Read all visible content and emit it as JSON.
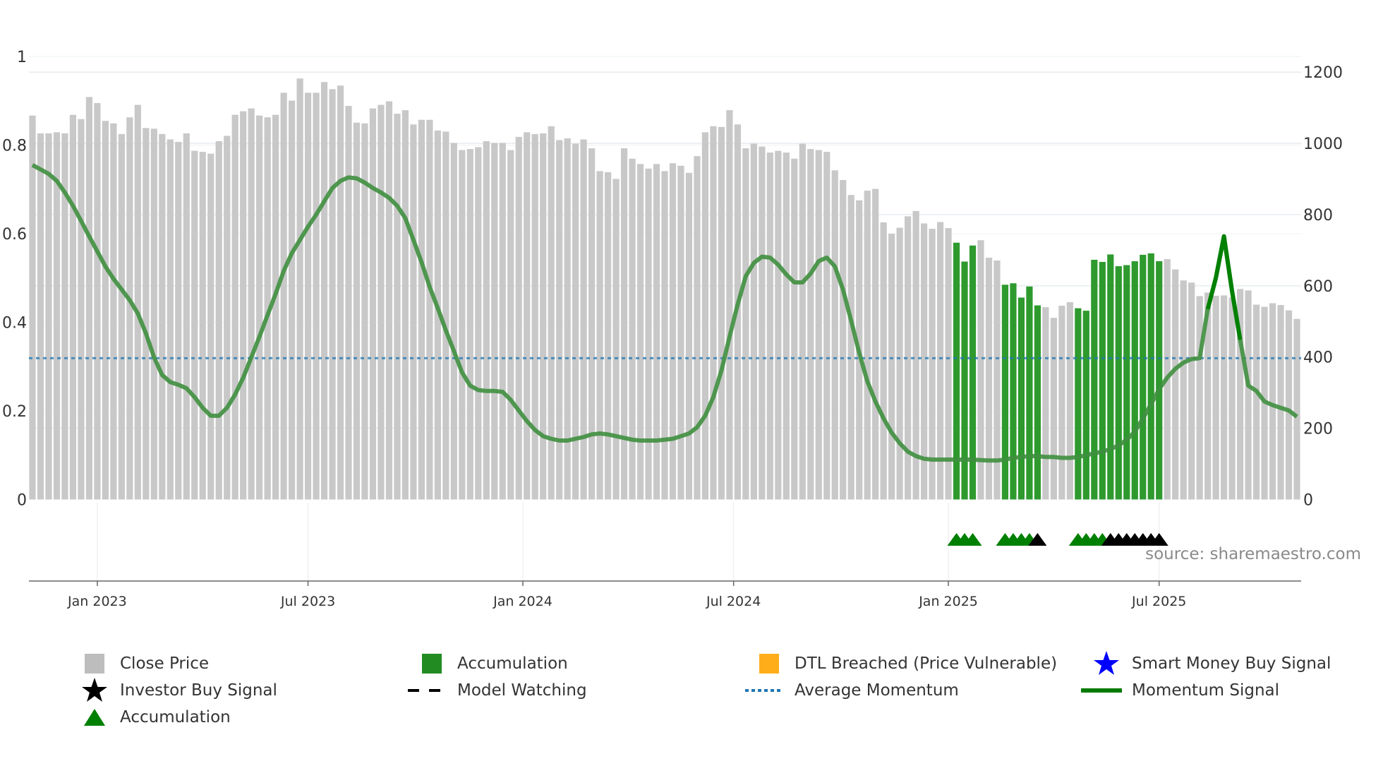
{
  "chart_data": {
    "type": "bar",
    "title": "",
    "source": "source: sharemaestro.com",
    "left_axis": {
      "ticks": [
        "0",
        "0.2",
        "0.4",
        "0.6",
        "0.8",
        "1"
      ],
      "range": [
        0,
        1
      ]
    },
    "right_axis": {
      "ticks": [
        "0",
        "200",
        "400",
        "600",
        "800",
        "1000",
        "1200"
      ],
      "range": [
        0,
        1200
      ]
    },
    "x_ticks": [
      "Jan 2023",
      "Jul 2023",
      "Jan 2024",
      "Jul 2024",
      "Jan 2025",
      "Jul 2025"
    ],
    "x_tick_weeks": [
      8,
      34,
      60.5,
      86.5,
      113,
      139
    ],
    "close_price": [
      1078,
      1028,
      1028,
      1031,
      1028,
      1080,
      1068,
      1130,
      1113,
      1063,
      1056,
      1026,
      1073,
      1108,
      1043,
      1041,
      1026,
      1011,
      1004,
      1028,
      979,
      976,
      971,
      1006,
      1021,
      1080,
      1090,
      1098,
      1078,
      1073,
      1080,
      1142,
      1120,
      1182,
      1142,
      1142,
      1172,
      1152,
      1162,
      1105,
      1058,
      1056,
      1098,
      1108,
      1118,
      1083,
      1093,
      1053,
      1066,
      1066,
      1036,
      1033,
      1001,
      981,
      984,
      989,
      1006,
      1001,
      1001,
      981,
      1018,
      1031,
      1026,
      1028,
      1048,
      1009,
      1014,
      999,
      1011,
      986,
      922,
      919,
      900,
      986,
      957,
      942,
      929,
      942,
      922,
      944,
      937,
      917,
      964,
      1031,
      1048,
      1046,
      1093,
      1053,
      986,
      999,
      991,
      974,
      979,
      974,
      957,
      999,
      984,
      981,
      976,
      924,
      897,
      855,
      840,
      867,
      872,
      778,
      746,
      763,
      795,
      810,
      775,
      760,
      779,
      762,
      721,
      668,
      713,
      728,
      679,
      671,
      603,
      607,
      567,
      598,
      545,
      540,
      510,
      544,
      554,
      537,
      530,
      673,
      667,
      688,
      655,
      658,
      669,
      687,
      691,
      669,
      675,
      646,
      615,
      609,
      571,
      581,
      572,
      573,
      567,
      591,
      587,
      547,
      541,
      551,
      546,
      531,
      507
    ],
    "accumulation_weeks": [
      114,
      115,
      116,
      120,
      121,
      122,
      123,
      124,
      129,
      130,
      131,
      132,
      133,
      134,
      135,
      136,
      137,
      138,
      139
    ],
    "signal_markers": [
      {
        "week": 114,
        "type": "accumulation"
      },
      {
        "week": 115,
        "type": "accumulation"
      },
      {
        "week": 116,
        "type": "accumulation"
      },
      {
        "week": 120,
        "type": "accumulation"
      },
      {
        "week": 121,
        "type": "accumulation"
      },
      {
        "week": 122,
        "type": "accumulation"
      },
      {
        "week": 123,
        "type": "accumulation"
      },
      {
        "week": 124,
        "type": "investor"
      },
      {
        "week": 129,
        "type": "accumulation"
      },
      {
        "week": 130,
        "type": "accumulation"
      },
      {
        "week": 131,
        "type": "accumulation"
      },
      {
        "week": 132,
        "type": "accumulation"
      },
      {
        "week": 133,
        "type": "investor"
      },
      {
        "week": 134,
        "type": "investor"
      },
      {
        "week": 135,
        "type": "investor"
      },
      {
        "week": 136,
        "type": "investor"
      },
      {
        "week": 137,
        "type": "investor"
      },
      {
        "week": 138,
        "type": "investor"
      },
      {
        "week": 139,
        "type": "investor"
      }
    ],
    "momentum": [
      0.755,
      0.745,
      0.735,
      0.719,
      0.693,
      0.663,
      0.629,
      0.594,
      0.56,
      0.526,
      0.498,
      0.474,
      0.45,
      0.42,
      0.375,
      0.321,
      0.281,
      0.265,
      0.259,
      0.251,
      0.231,
      0.207,
      0.189,
      0.189,
      0.207,
      0.237,
      0.275,
      0.321,
      0.367,
      0.416,
      0.464,
      0.516,
      0.556,
      0.586,
      0.616,
      0.643,
      0.673,
      0.703,
      0.719,
      0.727,
      0.725,
      0.715,
      0.703,
      0.693,
      0.681,
      0.663,
      0.635,
      0.586,
      0.536,
      0.48,
      0.432,
      0.382,
      0.335,
      0.287,
      0.257,
      0.247,
      0.245,
      0.245,
      0.243,
      0.225,
      0.201,
      0.177,
      0.157,
      0.143,
      0.137,
      0.133,
      0.133,
      0.137,
      0.141,
      0.147,
      0.149,
      0.147,
      0.143,
      0.139,
      0.135,
      0.133,
      0.133,
      0.133,
      0.135,
      0.137,
      0.143,
      0.149,
      0.163,
      0.189,
      0.231,
      0.291,
      0.367,
      0.44,
      0.504,
      0.534,
      0.548,
      0.546,
      0.53,
      0.508,
      0.49,
      0.49,
      0.51,
      0.538,
      0.546,
      0.526,
      0.474,
      0.404,
      0.331,
      0.267,
      0.221,
      0.183,
      0.151,
      0.127,
      0.108,
      0.098,
      0.092,
      0.09,
      0.09,
      0.09,
      0.09,
      0.09,
      0.09,
      0.089,
      0.088,
      0.088,
      0.09,
      0.094,
      0.096,
      0.098,
      0.098,
      0.096,
      0.096,
      0.094,
      0.094,
      0.096,
      0.1,
      0.104,
      0.108,
      0.114,
      0.122,
      0.135,
      0.153,
      0.183,
      0.215,
      0.249,
      0.275,
      0.295,
      0.309,
      0.317,
      0.319,
      0.43,
      0.5,
      0.594,
      0.47,
      0.361,
      0.257,
      0.245,
      0.221,
      0.213,
      0.207,
      0.201,
      0.187
    ],
    "momentum_highlight_range": [
      145,
      149
    ],
    "average_momentum": 0.319,
    "colors": {
      "close": "#c8c8c8",
      "accumulation": "#2e9a2e",
      "momentum": "#3f8f3f",
      "momentum_highlight": "#008000",
      "average": "#1f77b4",
      "dtl": "#ffae1a",
      "smart": "#0000ff",
      "investor": "#000000"
    }
  },
  "legend": [
    {
      "label": "Close Price",
      "icon": "square-gray"
    },
    {
      "label": "Accumulation",
      "icon": "square-green"
    },
    {
      "label": "DTL Breached (Price Vulnerable)",
      "icon": "square-orange"
    },
    {
      "label": "Smart Money Buy Signal",
      "icon": "star-blue"
    },
    {
      "label": "Investor Buy Signal",
      "icon": "star-black"
    },
    {
      "label": "Model Watching",
      "icon": "dash-black"
    },
    {
      "label": "Average Momentum",
      "icon": "dot-blue"
    },
    {
      "label": "Momentum Signal",
      "icon": "line-green"
    },
    {
      "label": "Accumulation",
      "icon": "triangle-green"
    }
  ]
}
